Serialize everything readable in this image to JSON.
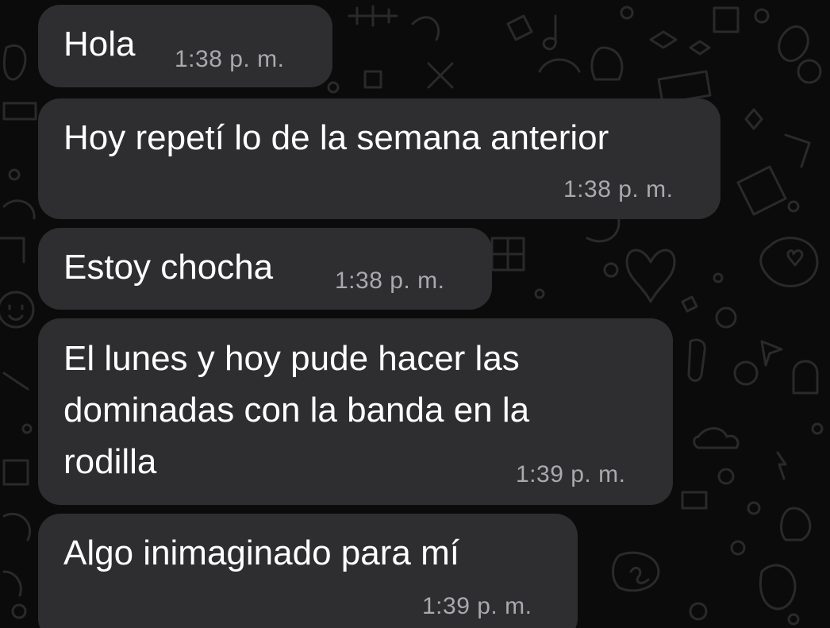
{
  "chat": {
    "messages": [
      {
        "text": "Hola",
        "time": "1:38 p. m."
      },
      {
        "text": "Hoy repetí lo de la semana anterior",
        "time": "1:38 p. m."
      },
      {
        "text": "Estoy chocha",
        "time": "1:38 p. m."
      },
      {
        "text": "El lunes y hoy pude hacer las dominadas con la banda en la rodilla",
        "time": "1:39 p. m."
      },
      {
        "text": "Algo inimaginado para mí",
        "time": "1:39 p. m."
      }
    ]
  },
  "theme": {
    "background": "#0b0b0b",
    "bubble": "#2e2e30",
    "text": "#ffffff",
    "timestamp": "#a9a9ae",
    "doodle": "#2a2a2a"
  }
}
